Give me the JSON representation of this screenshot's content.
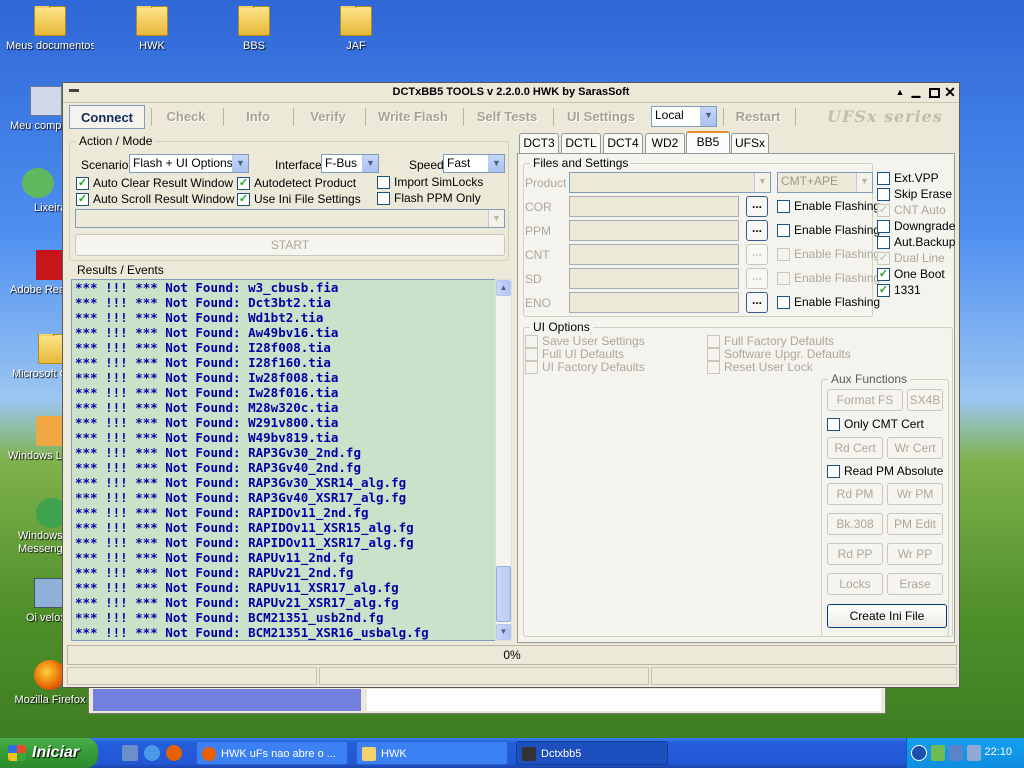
{
  "desktop": {
    "icons": [
      {
        "label": "Meus documentos",
        "icon": "my-documents-icon"
      },
      {
        "label": "HWK",
        "icon": "folder-icon"
      },
      {
        "label": "BBS",
        "icon": "folder-icon"
      },
      {
        "label": "JAF",
        "icon": "folder-icon"
      },
      {
        "label": "Meu compu",
        "icon": "my-computer-icon"
      },
      {
        "label": "Lixeira",
        "icon": "recycle-bin-icon"
      },
      {
        "label": "Adobe Rea",
        "icon": "adobe-reader-icon"
      },
      {
        "label": "Microsoft O",
        "icon": "folder-icon"
      },
      {
        "label": "Windows Liv",
        "icon": "windows-live-icon"
      },
      {
        "label": "Windows",
        "label2": "Messeng",
        "icon": "messenger-icon"
      },
      {
        "label": "Oi velox",
        "icon": "network-icon"
      },
      {
        "label": "Mozilla Firefox",
        "icon": "firefox-icon"
      }
    ]
  },
  "window": {
    "title": "DCTxBB5 TOOLS v 2.2.0.0 HWK by SarasSoft",
    "toolbar": {
      "connect": "Connect",
      "check": "Check",
      "info": "Info",
      "verify": "Verify",
      "write_flash": "Write Flash",
      "self_tests": "Self Tests",
      "ui_settings": "UI Settings",
      "local": "Local",
      "restart": "Restart",
      "brand": "UFSx series"
    },
    "action_mode": {
      "legend": "Action / Mode",
      "scenario_label": "Scenario",
      "scenario_value": "Flash + UI Options",
      "interface_label": "Interface",
      "interface_value": "F-Bus",
      "speed_label": "Speed",
      "speed_value": "Fast",
      "auto_clear": "Auto Clear Result Window",
      "auto_scroll": "Auto Scroll Result Window",
      "autodetect": "Autodetect Product",
      "use_ini": "Use Ini File Settings",
      "import_simlocks": "Import SimLocks",
      "flash_ppm_only": "Flash PPM Only",
      "start": "START"
    },
    "results": {
      "legend": "Results / Events",
      "lines": [
        "*** !!! *** Not Found: w3_cbusb.fia",
        "*** !!! *** Not Found: Dct3bt2.tia",
        "*** !!! *** Not Found: Wd1bt2.tia",
        "*** !!! *** Not Found: Aw49bv16.tia",
        "*** !!! *** Not Found: I28f008.tia",
        "*** !!! *** Not Found: I28f160.tia",
        "*** !!! *** Not Found: Iw28f008.tia",
        "*** !!! *** Not Found: Iw28f016.tia",
        "*** !!! *** Not Found: M28w320c.tia",
        "*** !!! *** Not Found: W291v800.tia",
        "*** !!! *** Not Found: W49bv819.tia",
        "*** !!! *** Not Found: RAP3Gv30_2nd.fg",
        "*** !!! *** Not Found: RAP3Gv40_2nd.fg",
        "*** !!! *** Not Found: RAP3Gv30_XSR14_alg.fg",
        "*** !!! *** Not Found: RAP3Gv40_XSR17_alg.fg",
        "*** !!! *** Not Found: RAPIDOv11_2nd.fg",
        "*** !!! *** Not Found: RAPIDOv11_XSR15_alg.fg",
        "*** !!! *** Not Found: RAPIDOv11_XSR17_alg.fg",
        "*** !!! *** Not Found: RAPUv11_2nd.fg",
        "*** !!! *** Not Found: RAPUv21_2nd.fg",
        "*** !!! *** Not Found: RAPUv11_XSR17_alg.fg",
        "*** !!! *** Not Found: RAPUv21_XSR17_alg.fg",
        "*** !!! *** Not Found: BCM21351_usb2nd.fg",
        "*** !!! *** Not Found: BCM21351_XSR16_usbalg.fg"
      ]
    },
    "tabs": [
      "DCT3",
      "DCTL",
      "DCT4",
      "WD2",
      "BB5",
      "UFSx"
    ],
    "files": {
      "legend": "Files and Settings",
      "product": "Product",
      "product_mode": "CMT+APE",
      "cor": "COR",
      "ppm": "PPM",
      "cnt": "CNT",
      "sd": "SD",
      "eno": "ENO",
      "browse": "...",
      "enable_flashing": "Enable Flashing",
      "ext_vpp": "Ext.VPP",
      "skip_erase": "Skip Erase",
      "cnt_auto": "CNT Auto",
      "downgrade": "Downgrade",
      "aut_backup": "Aut.Backup",
      "dual_line": "Dual Line",
      "one_boot": "One Boot",
      "n1331": "1331"
    },
    "ui_options": {
      "legend": "UI Options",
      "save_user": "Save User Settings",
      "full_ui": "Full UI Defaults",
      "ui_factory": "UI Factory Defaults",
      "full_factory": "Full Factory Defaults",
      "software_upgr": "Software Upgr. Defaults",
      "reset_user_lock": "Reset User Lock"
    },
    "aux": {
      "legend": "Aux Functions",
      "format_fs": "Format FS",
      "sx4b": "SX4B",
      "only_cmt": "Only CMT Cert",
      "rd_cert": "Rd Cert",
      "wr_cert": "Wr Cert",
      "read_pm_abs": "Read PM Absolute",
      "rd_pm": "Rd PM",
      "wr_pm": "Wr PM",
      "bk308": "Bk.308",
      "pm_edit": "PM Edit",
      "rd_pp": "Rd PP",
      "wr_pp": "Wr PP",
      "locks": "Locks",
      "erase": "Erase",
      "create_ini": "Create Ini File"
    },
    "status": {
      "progress_text": "0%"
    }
  },
  "background_window": {
    "progress": 0.34
  },
  "taskbar": {
    "start": "Iniciar",
    "tasks": [
      {
        "label": "HWK uFs nao abre o ...",
        "icon": "firefox-icon"
      },
      {
        "label": "HWK",
        "icon": "folder-icon"
      },
      {
        "label": "Dctxbb5",
        "icon": "app-icon"
      }
    ],
    "clock": "22:10"
  },
  "colors": {
    "log_bg": "#c9e2c9",
    "log_text": "#0000a8",
    "xp_blue": "#245edb",
    "tab_active": "#e68b2c"
  }
}
